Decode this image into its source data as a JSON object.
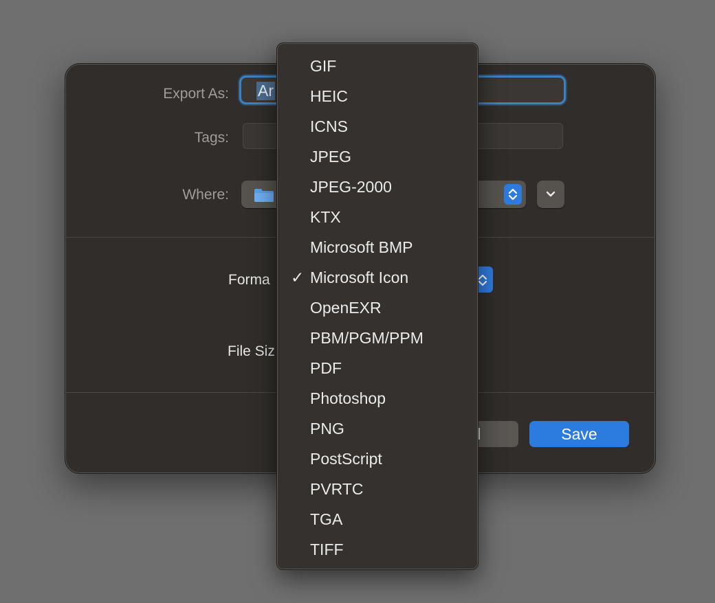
{
  "dialog": {
    "export_as_label": "Export As:",
    "export_as_value": "Ar",
    "tags_label": "Tags:",
    "where_label": "Where:",
    "format_label": "Forma",
    "file_size_label": "File Siz",
    "cancel_label": "cel",
    "save_label": "Save"
  },
  "format_menu": {
    "selected": "Microsoft Icon",
    "check_glyph": "✓",
    "items": [
      {
        "label": "GIF"
      },
      {
        "label": "HEIC"
      },
      {
        "label": "ICNS"
      },
      {
        "label": "JPEG"
      },
      {
        "label": "JPEG-2000"
      },
      {
        "label": "KTX"
      },
      {
        "label": "Microsoft BMP"
      },
      {
        "label": "Microsoft Icon",
        "checked": true
      },
      {
        "label": "OpenEXR"
      },
      {
        "label": "PBM/PGM/PPM"
      },
      {
        "label": "PDF"
      },
      {
        "label": "Photoshop"
      },
      {
        "label": "PNG"
      },
      {
        "label": "PostScript"
      },
      {
        "label": "PVRTC"
      },
      {
        "label": "TGA"
      },
      {
        "label": "TIFF"
      }
    ]
  },
  "icons": {
    "folder": "folder-icon",
    "stepper": "up-down-chevron-icon",
    "expand": "chevron-down-icon"
  },
  "colors": {
    "accent": "#2c7cdf",
    "focus_ring": "#3b82c4",
    "background": "#6f6f6f",
    "dialog": "#302d2a",
    "menu": "#34312e"
  }
}
